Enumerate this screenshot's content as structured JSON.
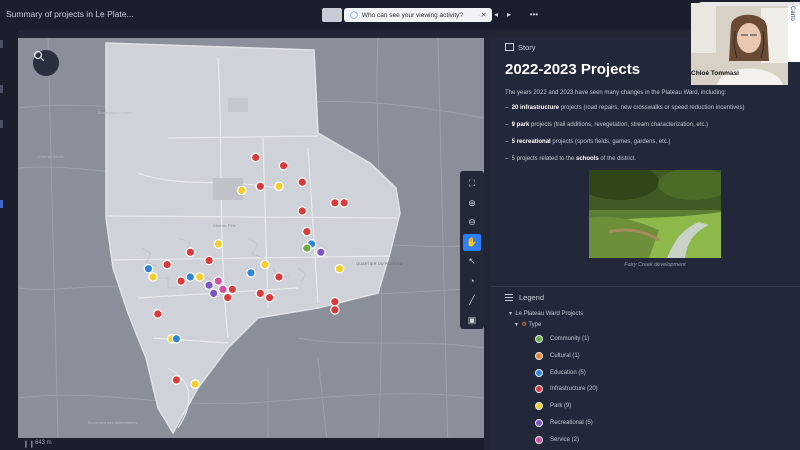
{
  "header": {
    "doc_title": "Summary of projects in Le Plate...",
    "share_prompt": "Who can see your viewing activity?",
    "share_close": "✕",
    "more": "•••"
  },
  "map": {
    "scale_text": "643 m",
    "labels": [
      "Chemin Pink",
      "QUARTIER DU PLATEAU",
      "Boulevard des Allumettières",
      "Chemin Vanier",
      "Boulevard Lucerne"
    ],
    "markers": [
      {
        "type": "Infrastructure",
        "lon": 0.51,
        "lat": 0.29
      },
      {
        "type": "Infrastructure",
        "lon": 0.57,
        "lat": 0.31
      },
      {
        "type": "Infrastructure",
        "lon": 0.61,
        "lat": 0.35
      },
      {
        "type": "Park",
        "lon": 0.48,
        "lat": 0.37
      },
      {
        "type": "Park",
        "lon": 0.56,
        "lat": 0.36
      },
      {
        "type": "Infrastructure",
        "lon": 0.52,
        "lat": 0.36
      },
      {
        "type": "Infrastructure",
        "lon": 0.61,
        "lat": 0.42
      },
      {
        "type": "Infrastructure",
        "lon": 0.68,
        "lat": 0.4
      },
      {
        "type": "Infrastructure",
        "lon": 0.7,
        "lat": 0.4
      },
      {
        "type": "Infrastructure",
        "lon": 0.62,
        "lat": 0.47
      },
      {
        "type": "Education",
        "lon": 0.63,
        "lat": 0.5
      },
      {
        "type": "Community",
        "lon": 0.62,
        "lat": 0.51
      },
      {
        "type": "Recreational",
        "lon": 0.65,
        "lat": 0.52
      },
      {
        "type": "Park",
        "lon": 0.43,
        "lat": 0.5
      },
      {
        "type": "Infrastructure",
        "lon": 0.37,
        "lat": 0.52
      },
      {
        "type": "Infrastructure",
        "lon": 0.41,
        "lat": 0.54
      },
      {
        "type": "Infrastructure",
        "lon": 0.32,
        "lat": 0.55
      },
      {
        "type": "Education",
        "lon": 0.28,
        "lat": 0.56
      },
      {
        "type": "Park",
        "lon": 0.29,
        "lat": 0.58
      },
      {
        "type": "Education",
        "lon": 0.37,
        "lat": 0.58
      },
      {
        "type": "Park",
        "lon": 0.39,
        "lat": 0.58
      },
      {
        "type": "Infrastructure",
        "lon": 0.35,
        "lat": 0.59
      },
      {
        "type": "Recreational",
        "lon": 0.41,
        "lat": 0.6
      },
      {
        "type": "Service",
        "lon": 0.43,
        "lat": 0.59
      },
      {
        "type": "Park",
        "lon": 0.53,
        "lat": 0.55
      },
      {
        "type": "Infrastructure",
        "lon": 0.5,
        "lat": 0.57
      },
      {
        "type": "Education",
        "lon": 0.5,
        "lat": 0.57
      },
      {
        "type": "Infrastructure",
        "lon": 0.56,
        "lat": 0.58
      },
      {
        "type": "Park",
        "lon": 0.69,
        "lat": 0.56
      },
      {
        "type": "Infrastructure",
        "lon": 0.46,
        "lat": 0.61
      },
      {
        "type": "Service",
        "lon": 0.44,
        "lat": 0.61
      },
      {
        "type": "Recreational",
        "lon": 0.42,
        "lat": 0.62
      },
      {
        "type": "Infrastructure",
        "lon": 0.45,
        "lat": 0.63
      },
      {
        "type": "Infrastructure",
        "lon": 0.52,
        "lat": 0.62
      },
      {
        "type": "Infrastructure",
        "lon": 0.54,
        "lat": 0.63
      },
      {
        "type": "Infrastructure",
        "lon": 0.68,
        "lat": 0.64
      },
      {
        "type": "Infrastructure",
        "lon": 0.68,
        "lat": 0.66
      },
      {
        "type": "Infrastructure",
        "lon": 0.3,
        "lat": 0.67
      },
      {
        "type": "Park",
        "lon": 0.33,
        "lat": 0.73
      },
      {
        "type": "Education",
        "lon": 0.34,
        "lat": 0.73
      },
      {
        "type": "Infrastructure",
        "lon": 0.34,
        "lat": 0.83
      },
      {
        "type": "Park",
        "lon": 0.38,
        "lat": 0.84
      }
    ]
  },
  "toolbar_tools": [
    {
      "name": "fullscreen-icon",
      "glyph": "⛶"
    },
    {
      "name": "zoom-in-icon",
      "glyph": "⊕"
    },
    {
      "name": "zoom-out-icon",
      "glyph": "⊖"
    },
    {
      "name": "pan-hand-icon",
      "glyph": "✋"
    },
    {
      "name": "select-pointer-icon",
      "glyph": "↖"
    },
    {
      "name": "identify-icon",
      "glyph": "◔"
    },
    {
      "name": "measure-ruler-icon",
      "glyph": "╱"
    },
    {
      "name": "screenshot-icon",
      "glyph": "▣"
    }
  ],
  "story": {
    "label": "Story",
    "title": "2022-2023 Projects",
    "intro": "The years 2022 and 2023 have seen many changes in the Plateau Ward, including:",
    "bullets": [
      {
        "bold": "20 infrastructure",
        "rest": " projects (road repairs, new crosswalks or speed reduction incentives)"
      },
      {
        "bold": "9 park",
        "rest": " projects (trail additions, revegetation, stream characterization, etc.)"
      },
      {
        "bold": "5 recreational",
        "rest": " projects (sports fields, games, gardens, etc.)"
      },
      {
        "bold": "",
        "rest": "5 projects related to the ",
        "bold2": "schools",
        "rest2": " of the district."
      }
    ],
    "caption": "Fairy Creek development"
  },
  "legend": {
    "label": "Legend",
    "group": "Le Plateau Ward Projects",
    "sub": "Type",
    "items": [
      {
        "name": "Community (1)",
        "color": "#6dab45"
      },
      {
        "name": "Cultural (1)",
        "color": "#e8873a"
      },
      {
        "name": "Education (5)",
        "color": "#2f86d6"
      },
      {
        "name": "Infrastructure (20)",
        "color": "#d93a3a"
      },
      {
        "name": "Park (9)",
        "color": "#f2cf2c"
      },
      {
        "name": "Recreational (5)",
        "color": "#7d55bf"
      },
      {
        "name": "Service (2)",
        "color": "#cf4fa3"
      }
    ]
  },
  "webcam": {
    "name": "Chloé Tommasi"
  },
  "brand": {
    "name": "Carto"
  }
}
